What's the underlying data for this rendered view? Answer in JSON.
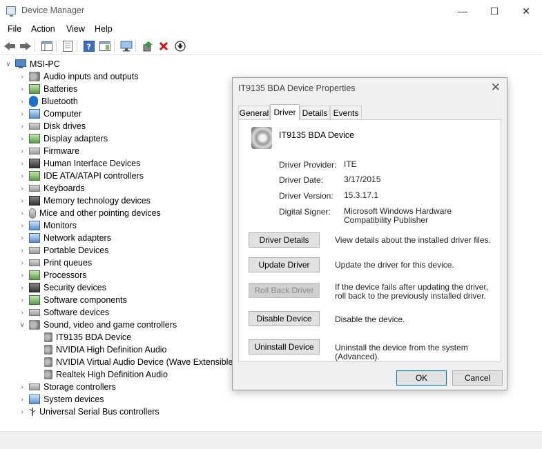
{
  "window": {
    "title": "Device Manager",
    "minimize": "—",
    "maximize": "☐",
    "close": "✕"
  },
  "menu": [
    "File",
    "Action",
    "View",
    "Help"
  ],
  "tree": {
    "root": "MSI-PC",
    "categories": [
      "Audio inputs and outputs",
      "Batteries",
      "Bluetooth",
      "Computer",
      "Disk drives",
      "Display adapters",
      "Firmware",
      "Human Interface Devices",
      "IDE ATA/ATAPI controllers",
      "Keyboards",
      "Memory technology devices",
      "Mice and other pointing devices",
      "Monitors",
      "Network adapters",
      "Portable Devices",
      "Print queues",
      "Processors",
      "Security devices",
      "Software components",
      "Software devices",
      "Sound, video and game controllers"
    ],
    "sound_children": [
      "IT9135 BDA Device",
      "NVIDIA High Definition Audio",
      "NVIDIA Virtual Audio Device (Wave Extensible) (",
      "Realtek High Definition Audio"
    ],
    "after": [
      "Storage controllers",
      "System devices",
      "Universal Serial Bus controllers"
    ]
  },
  "dialog": {
    "title": "IT9135 BDA Device Properties",
    "close": "✕",
    "tabs": [
      "General",
      "Driver",
      "Details",
      "Events"
    ],
    "active_tab": "Driver",
    "device_name": "IT9135 BDA Device",
    "fields": {
      "provider_label": "Driver Provider:",
      "provider": "ITE",
      "date_label": "Driver Date:",
      "date": "3/17/2015",
      "version_label": "Driver Version:",
      "version": "15.3.17.1",
      "signer_label": "Digital Signer:",
      "signer": "Microsoft Windows Hardware Compatibility Publisher"
    },
    "actions": {
      "details_btn": "Driver Details",
      "details_desc": "View details about the installed driver files.",
      "update_btn": "Update Driver",
      "update_desc": "Update the driver for this device.",
      "rollback_btn": "Roll Back Driver",
      "rollback_desc": "If the device fails after updating the driver, roll back to the previously installed driver.",
      "disable_btn": "Disable Device",
      "disable_desc": "Disable the device.",
      "uninstall_btn": "Uninstall Device",
      "uninstall_desc": "Uninstall the device from the system (Advanced)."
    },
    "ok": "OK",
    "cancel": "Cancel"
  }
}
